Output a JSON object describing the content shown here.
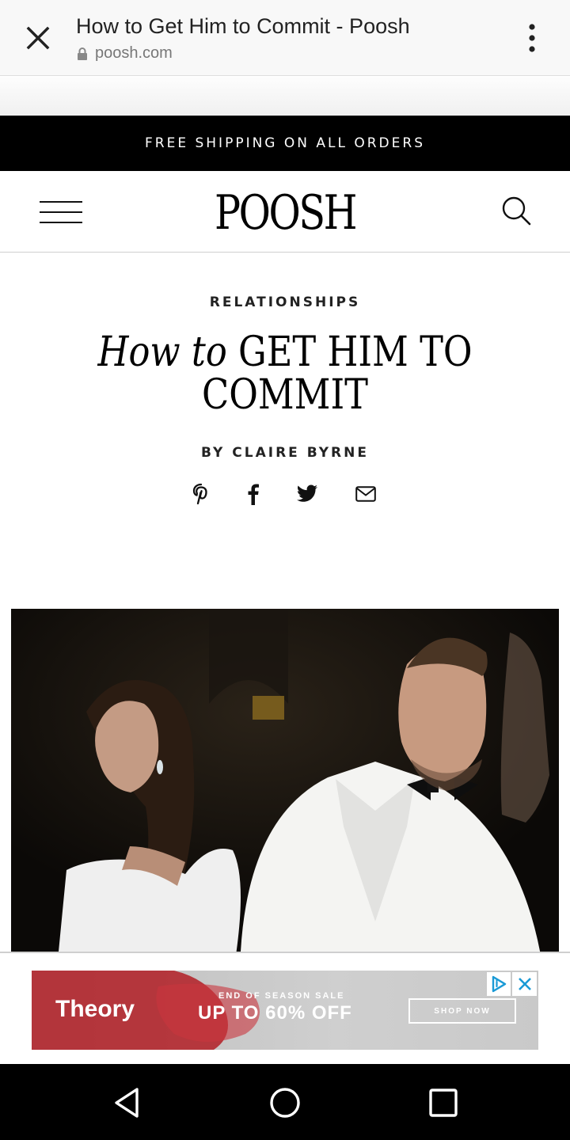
{
  "browser": {
    "title": "How to Get Him to Commit - Poosh",
    "url": "poosh.com"
  },
  "announcement": "FREE SHIPPING ON ALL ORDERS",
  "site": {
    "logo": "POOSH"
  },
  "article": {
    "category": "RELATIONSHIPS",
    "headline_italic": "How to",
    "headline_rest": "GET HIM TO COMMIT",
    "byline": "BY CLAIRE BYRNE",
    "share_icons": [
      "pinterest-icon",
      "facebook-icon",
      "twitter-icon",
      "email-icon"
    ]
  },
  "ad": {
    "brand": "Theory",
    "sale_label": "END OF SEASON SALE",
    "offer": "UP TO 60% OFF",
    "cta": "SHOP NOW"
  },
  "colors": {
    "announcement_bg": "#000000",
    "accent_adchoices": "#1a9ad6"
  }
}
